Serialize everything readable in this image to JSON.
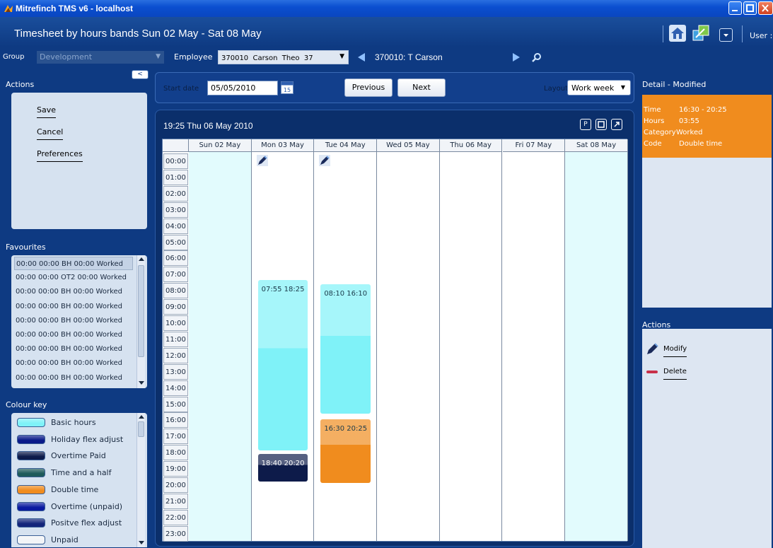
{
  "window": {
    "title": "Mitrefinch TMS v6 - localhost"
  },
  "header": {
    "page_title": "Timesheet by hours bands Sun 02 May - Sat 08 May",
    "user_label": "User :"
  },
  "filters": {
    "group_label": "Group",
    "group_value": "Development",
    "employee_label": "Employee",
    "employee_value": "370010  Carson  Theo  37",
    "employee_name": "370010: T Carson"
  },
  "left": {
    "actions_title": "Actions",
    "collapse_label": "<",
    "actions": [
      "Save",
      "Cancel",
      "Preferences"
    ],
    "favourites_title": "Favourites",
    "favourites": [
      "00:00 00:00 BH 00:00 Worked",
      "00:00 00:00 OT2 00:00 Worked",
      "00:00 00:00 BH 00:00 Worked",
      "00:00 00:00 BH 00:00 Worked",
      "00:00 00:00 BH 00:00 Worked",
      "00:00 00:00 BH 00:00 Worked",
      "00:00 00:00 BH 00:00 Worked",
      "00:00 00:00 BH 00:00 Worked",
      "00:00 00:00 BH 00:00 Worked"
    ],
    "colour_key_title": "Colour key",
    "colour_key": [
      {
        "label": "Basic hours",
        "color": "#7ff2f8"
      },
      {
        "label": "Holiday flex adjust",
        "color": "#0a1a8a"
      },
      {
        "label": "Overtime Paid",
        "color": "#0d1b4a"
      },
      {
        "label": "Time and a half",
        "color": "#1e5a5a"
      },
      {
        "label": "Double time",
        "color": "#f08c1e"
      },
      {
        "label": "Overtime (unpaid)",
        "color": "#0a1aa0"
      },
      {
        "label": "Positve flex adjust",
        "color": "#13247a"
      },
      {
        "label": "Unpaid",
        "color": "#f2f4f7"
      }
    ]
  },
  "toolbar": {
    "start_date_label": "Start date",
    "start_date_value": "05/05/2010",
    "calendar_day": "15",
    "previous_label": "Previous",
    "next_label": "Next",
    "layout_label": "Layout",
    "layout_value": "Work week"
  },
  "calendar": {
    "title": "19:25 Thu 06 May 2010",
    "tool_p": "P",
    "days": [
      "Sun 02 May",
      "Mon 03 May",
      "Tue 04 May",
      "Wed 05 May",
      "Thu 06 May",
      "Fri 07 May",
      "Sat 08 May"
    ],
    "hours": [
      "00:00",
      "01:00",
      "02:00",
      "03:00",
      "04:00",
      "05:00",
      "06:00",
      "07:00",
      "08:00",
      "09:00",
      "10:00",
      "11:00",
      "12:00",
      "13:00",
      "14:00",
      "15:00",
      "16:00",
      "17:00",
      "18:00",
      "19:00",
      "20:00",
      "21:00",
      "22:00",
      "23:00"
    ],
    "events": [
      {
        "day": 1,
        "start": 7.9167,
        "end": 18.4167,
        "label": "07:55 18:25",
        "category": "Basic hours",
        "color": "#7ff2f8"
      },
      {
        "day": 1,
        "start": 18.6667,
        "end": 20.3333,
        "label": "18:40 20:20",
        "category": "Overtime Paid",
        "color": "#0d1b4a"
      },
      {
        "day": 2,
        "start": 8.1667,
        "end": 16.1667,
        "label": "08:10 16:10",
        "category": "Basic hours",
        "color": "#7ff2f8"
      },
      {
        "day": 2,
        "start": 16.5,
        "end": 20.4167,
        "label": "16:30 20:25",
        "category": "Double time",
        "color": "#f08c1e"
      }
    ]
  },
  "detail": {
    "title": "Detail - Modified",
    "rows": [
      {
        "key": "Time",
        "value": "16:30 - 20:25"
      },
      {
        "key": "Hours",
        "value": "03:55"
      },
      {
        "key": "Category",
        "value": "Worked"
      },
      {
        "key": "Code",
        "value": "Double time"
      }
    ]
  },
  "right_actions": {
    "title": "Actions",
    "modify_label": "Modify",
    "delete_label": "Delete"
  }
}
